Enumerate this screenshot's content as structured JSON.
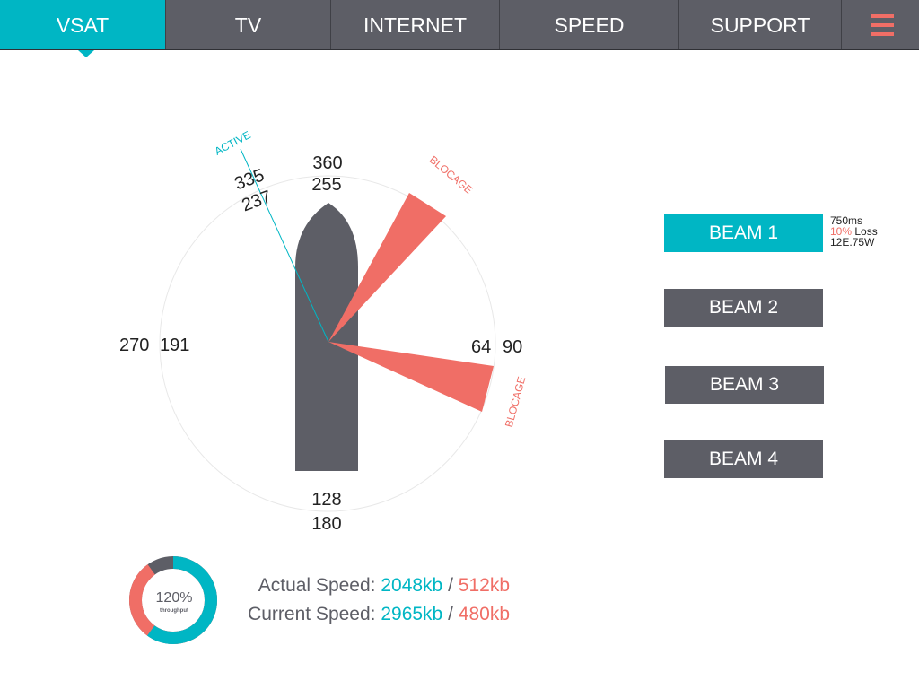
{
  "nav": {
    "tabs": [
      {
        "label": "VSAT",
        "active": true
      },
      {
        "label": "TV",
        "active": false
      },
      {
        "label": "INTERNET",
        "active": false
      },
      {
        "label": "SPEED",
        "active": false
      },
      {
        "label": "SUPPORT",
        "active": false
      }
    ],
    "menu_icon": "hamburger-menu-icon"
  },
  "compass": {
    "north_outer": "360",
    "north_inner": "255",
    "nw_outer": "335",
    "nw_inner": "237",
    "east_inner": "64",
    "east_outer": "90",
    "west_outer": "270",
    "west_inner": "191",
    "south_inner": "128",
    "south_outer": "180",
    "active_label": "ACTIVE",
    "blockage_label_1": "BLOCAGE",
    "blockage_label_2": "BLOCAGE"
  },
  "beams": [
    {
      "label": "BEAM 1",
      "active": true
    },
    {
      "label": "BEAM 2",
      "active": false
    },
    {
      "label": "BEAM 3",
      "active": false
    },
    {
      "label": "BEAM 4",
      "active": false
    }
  ],
  "beam_info": {
    "latency": "750ms",
    "loss_pct": "10%",
    "loss_label": "Loss",
    "position": "12E.75W"
  },
  "throughput": {
    "value": "120%",
    "label": "throughput",
    "fraction_teal": 0.6,
    "fraction_coral": 0.3,
    "fraction_gray": 0.1
  },
  "speeds": {
    "actual_label": "Actual Speed:",
    "actual_down": "2048kb",
    "actual_up": "512kb",
    "current_label": "Current Speed:",
    "current_down": "2965kb",
    "current_up": "480kb",
    "separator": "/"
  },
  "colors": {
    "accent": "#00b6c4",
    "warning": "#f06e66",
    "dark": "#5d5e66"
  }
}
